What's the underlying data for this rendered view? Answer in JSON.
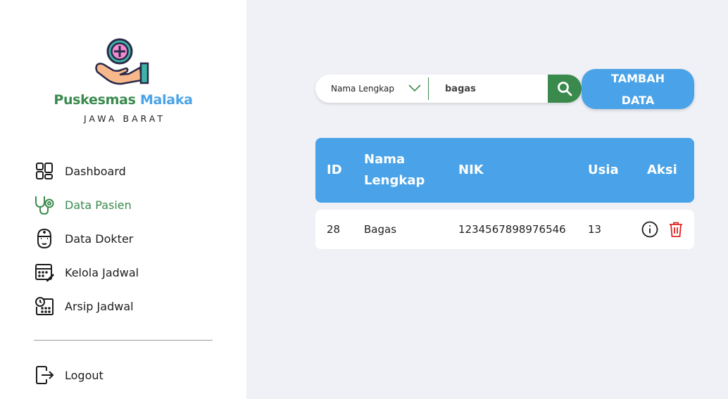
{
  "brand": {
    "name_part1": "Puskesmas",
    "name_part2": "Malaka",
    "region": "JAWA BARAT"
  },
  "sidebar": {
    "items": [
      {
        "label": "Dashboard",
        "icon": "dashboard-grid-icon",
        "active": false
      },
      {
        "label": "Data Pasien",
        "icon": "stethoscope-icon",
        "active": true
      },
      {
        "label": "Data Dokter",
        "icon": "doctor-icon",
        "active": false
      },
      {
        "label": "Kelola Jadwal",
        "icon": "calendar-edit-icon",
        "active": false
      },
      {
        "label": "Arsip Jadwal",
        "icon": "calendar-clock-icon",
        "active": false
      }
    ],
    "logout_label": "Logout"
  },
  "search": {
    "filter_value": "Nama Lengkap",
    "query": "bagas",
    "button_icon": "search-icon"
  },
  "toolbar": {
    "add_label": "TAMBAH DATA"
  },
  "table": {
    "columns": [
      "ID",
      "Nama Lengkap",
      "NIK",
      "Usia",
      "Aksi"
    ],
    "rows": [
      {
        "id": "28",
        "name": "Bagas",
        "nik": "1234567898976546",
        "age": "13"
      }
    ]
  },
  "colors": {
    "green": "#3a8a4e",
    "blue": "#4aa3e8",
    "background": "#eff1f6",
    "delete": "#e02424"
  }
}
